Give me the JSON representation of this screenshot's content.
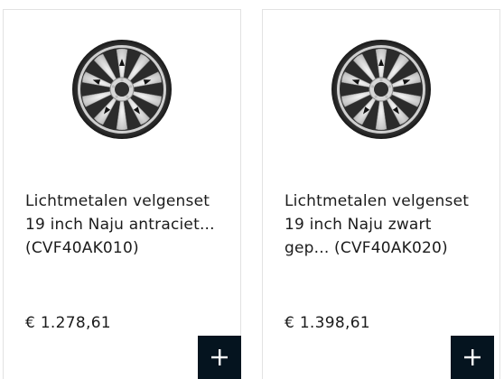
{
  "products": [
    {
      "title_lines": [
        "Lichtmetalen velgenset",
        "19 inch Naju antraciet...",
        "(CVF40AK010)"
      ],
      "price": "€ 1.278,61",
      "add_icon": "plus-icon",
      "image_icon": "alloy-wheel-image"
    },
    {
      "title_lines": [
        "Lichtmetalen velgenset",
        "19 inch Naju zwart",
        "gep... (CVF40AK020)"
      ],
      "price": "€ 1.398,61",
      "add_icon": "plus-icon",
      "image_icon": "alloy-wheel-image"
    }
  ],
  "colors": {
    "button_bg": "#05141f",
    "text": "#1b1b1b",
    "card_border": "#e2e2e2"
  }
}
